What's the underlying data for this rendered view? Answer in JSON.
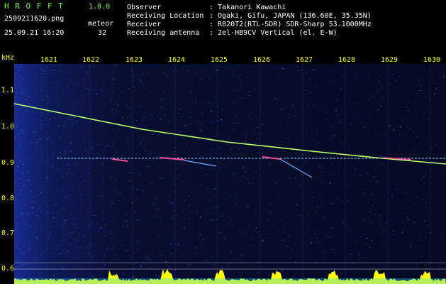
{
  "header": {
    "brand": "H R O F F T",
    "version": "1.0.0",
    "filename": "2509211620.png",
    "datetime": "25.09.21 16:20",
    "meteor_label": "meteor",
    "meteor_count": "32",
    "info": [
      {
        "key": "Observer",
        "value": ": Takanori Kawachi"
      },
      {
        "key": "Receiving Location",
        "value": ": Ogaki, Gifu, JAPAN (136.60E, 35.35N)"
      },
      {
        "key": "Receiver",
        "value": ": R820T2(RTL-SDR) SDR-Sharp 53.1000MHz"
      },
      {
        "key": "Receiving antenna",
        "value": ": 2el-HB9CV Vertical (el. E-W)"
      }
    ]
  },
  "axes": {
    "y_unit": "kHz",
    "x_ticks": [
      "1621",
      "1622",
      "1623",
      "1624",
      "1625",
      "1626",
      "1627",
      "1628",
      "1629",
      "1630"
    ],
    "y_ticks": [
      "1.1",
      "1.0",
      "0.9",
      "0.8",
      "0.7",
      "0.6"
    ]
  },
  "colors": {
    "background": "#000000",
    "noise": "#1a2fa0",
    "drift_line": "#b8ff6a",
    "carrier_line": "#7fd8ff",
    "bottom_bar": "#ffff00",
    "text_lime": "#6dff3f",
    "text_yellow": "#ffff00"
  }
}
